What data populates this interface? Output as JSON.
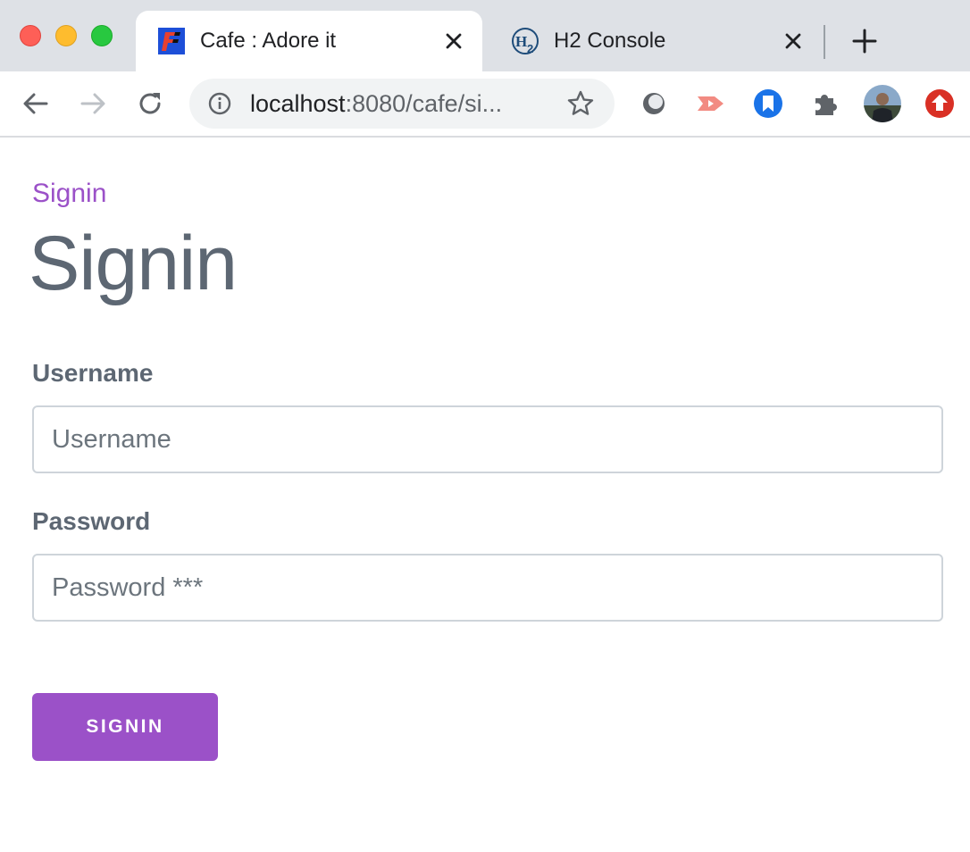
{
  "browser": {
    "tabs": [
      {
        "title": "Cafe : Adore it",
        "active": true,
        "favicon": "cafe-favicon-icon"
      },
      {
        "title": "H2 Console",
        "active": false,
        "favicon": "h2-favicon-icon"
      }
    ],
    "address_bar": {
      "url_host": "localhost",
      "url_rest": ":8080/cafe/si..."
    },
    "extensions": [
      "ring-extension-icon",
      "video-extension-icon",
      "bookmark-extension-icon",
      "puzzle-extensions-icon",
      "profile-avatar",
      "upload-extension-icon"
    ]
  },
  "page": {
    "breadcrumb": "Signin",
    "heading": "Signin",
    "form": {
      "username_label": "Username",
      "username_placeholder": "Username",
      "username_value": "",
      "password_label": "Password",
      "password_placeholder": "Password ***",
      "password_value": "",
      "submit_label": "SIGNIN"
    }
  },
  "colors": {
    "accent": "#9b51c8",
    "text": "#5d6773",
    "tabstrip": "#dee1e6"
  }
}
